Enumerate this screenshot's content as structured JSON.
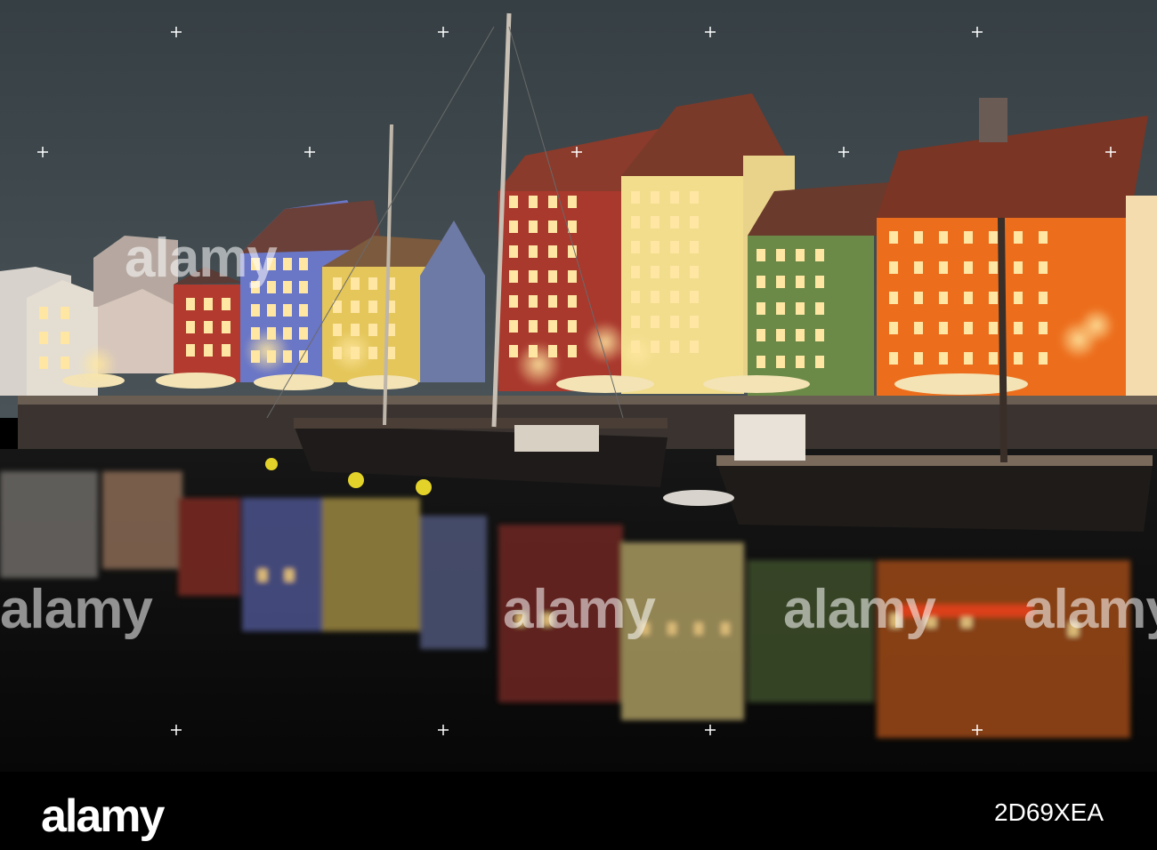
{
  "image": {
    "alt": "Nyhavn canal at night with colourful illuminated townhouses, moored wooden sailing boats and reflections in the water"
  },
  "watermark": {
    "text": "alamy"
  },
  "footer": {
    "logo": "alamy",
    "image_id": "2D69XEA"
  },
  "colors": {
    "sky": "#3d464b",
    "water": "#0c0c0c",
    "footer_bg": "#000000",
    "orange_house": "#e86a1c",
    "yellow_house": "#f3dc84",
    "blue_house": "#6a78c8",
    "green_house": "#6f8a4a",
    "red_house": "#a3362b"
  }
}
